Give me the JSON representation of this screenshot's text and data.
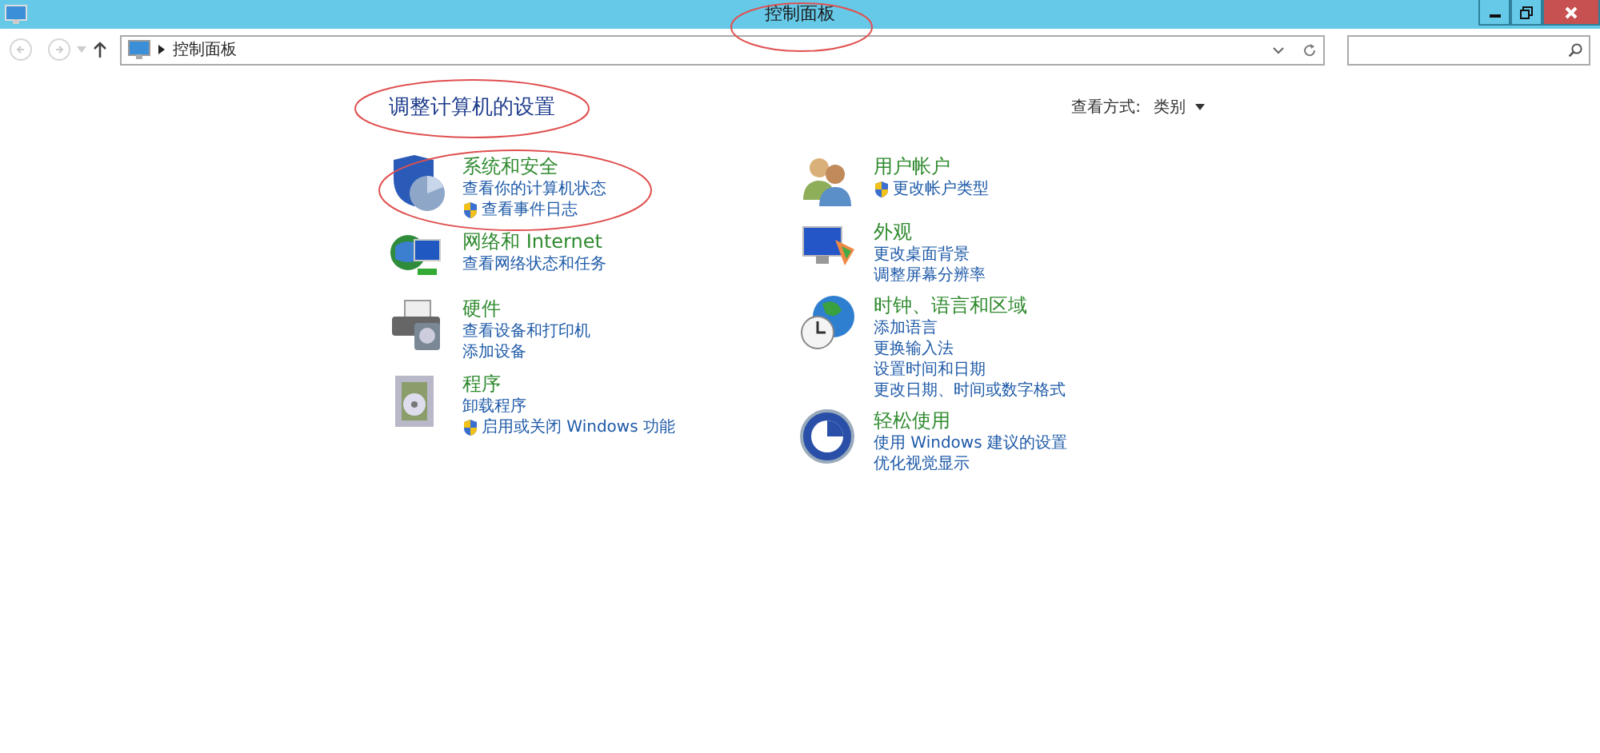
{
  "window": {
    "title": "控制面板"
  },
  "address_bar": {
    "path": "控制面板"
  },
  "heading": "调整计算机的设置",
  "view_by": {
    "label": "查看方式:",
    "value": "类别"
  },
  "columns": [
    [
      {
        "title": "系统和安全",
        "links": [
          {
            "text": "查看你的计算机状态",
            "shield": false
          },
          {
            "text": "查看事件日志",
            "shield": true
          }
        ]
      },
      {
        "title": "网络和 Internet",
        "links": [
          {
            "text": "查看网络状态和任务",
            "shield": false
          }
        ]
      },
      {
        "title": "硬件",
        "links": [
          {
            "text": "查看设备和打印机",
            "shield": false
          },
          {
            "text": "添加设备",
            "shield": false
          }
        ]
      },
      {
        "title": "程序",
        "links": [
          {
            "text": "卸载程序",
            "shield": false
          },
          {
            "text": "启用或关闭 Windows 功能",
            "shield": true
          }
        ]
      }
    ],
    [
      {
        "title": "用户帐户",
        "links": [
          {
            "text": "更改帐户类型",
            "shield": true
          }
        ]
      },
      {
        "title": "外观",
        "links": [
          {
            "text": "更改桌面背景",
            "shield": false
          },
          {
            "text": "调整屏幕分辨率",
            "shield": false
          }
        ]
      },
      {
        "title": "时钟、语言和区域",
        "links": [
          {
            "text": "添加语言",
            "shield": false
          },
          {
            "text": "更换输入法",
            "shield": false
          },
          {
            "text": "设置时间和日期",
            "shield": false
          },
          {
            "text": "更改日期、时间或数字格式",
            "shield": false
          }
        ]
      },
      {
        "title": "轻松使用",
        "links": [
          {
            "text": "使用 Windows 建议的设置",
            "shield": false
          },
          {
            "text": "优化视觉显示",
            "shield": false
          }
        ]
      }
    ]
  ]
}
